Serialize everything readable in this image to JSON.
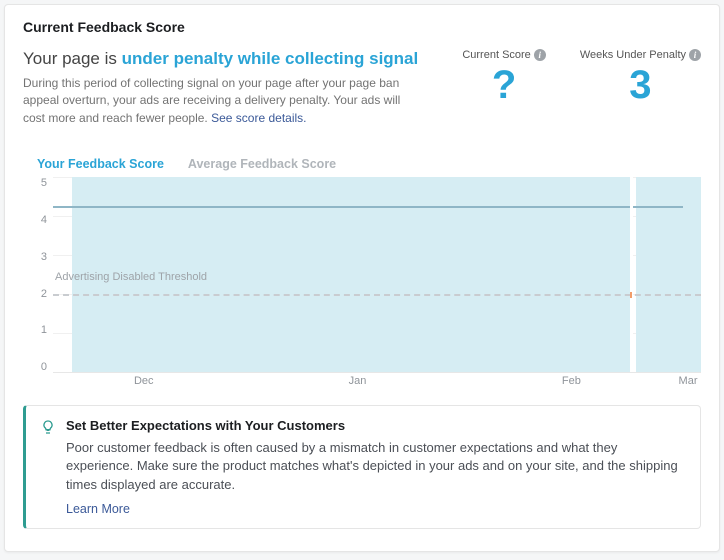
{
  "title": "Current Feedback Score",
  "status": {
    "prefix": "Your page is ",
    "highlight": "under penalty while collecting signal"
  },
  "description": "During this period of collecting signal on your page after your page ban appeal overturn, your ads are receiving a delivery penalty. Your ads will cost more and reach fewer people. ",
  "see_details": "See score details.",
  "metrics": {
    "current_label": "Current Score",
    "current_value": "?",
    "weeks_label": "Weeks Under Penalty",
    "weeks_value": "3"
  },
  "tabs": {
    "yours": "Your Feedback Score",
    "average": "Average Feedback Score"
  },
  "yticks": [
    "5",
    "4",
    "3",
    "2",
    "1",
    "0"
  ],
  "xticks": [
    {
      "label": "Dec",
      "pct": 14
    },
    {
      "label": "Jan",
      "pct": 47
    },
    {
      "label": "Feb",
      "pct": 80
    },
    {
      "label": "Mar",
      "pct": 98
    }
  ],
  "threshold_label": "Advertising Disabled Threshold",
  "tip": {
    "title": "Set Better Expectations with Your Customers",
    "text": "Poor customer feedback is often caused by a mismatch in customer expectations and what they experience. Make sure the product matches what's depicted in your ads and on your site, and the shipping times displayed are accurate.",
    "link": "Learn More"
  },
  "chart_data": {
    "type": "area",
    "ylim": [
      0,
      5
    ],
    "threshold": 2,
    "current_score": 4.25,
    "x_range": [
      "Nov",
      "Mar"
    ],
    "area_start_pct": 3,
    "area_end_pct": 100,
    "gap_pct": 89,
    "series": [
      {
        "name": "Your Feedback Score",
        "value_constant": 4.25
      },
      {
        "name": "Average Feedback Score"
      }
    ]
  }
}
